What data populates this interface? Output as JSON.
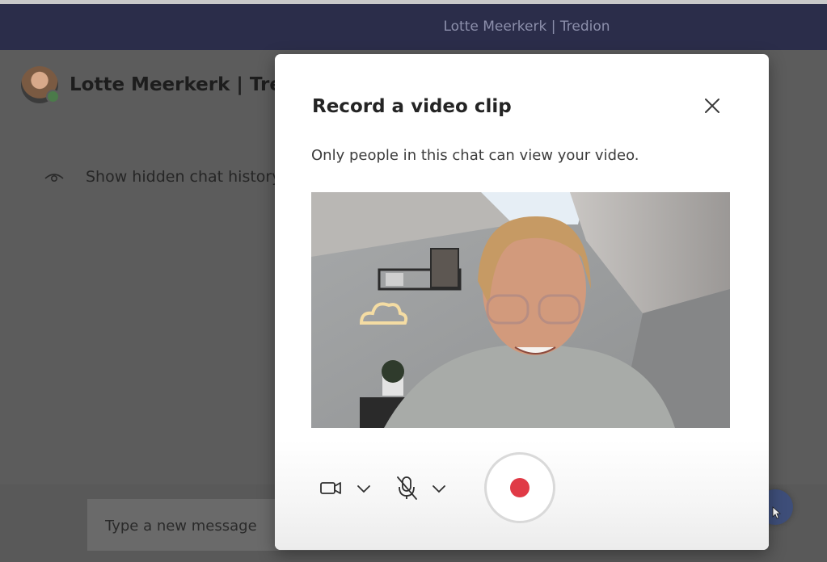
{
  "window": {
    "title": "Lotte Meerkerk | Tredion"
  },
  "chat": {
    "name": "Lotte Meerkerk | Tredion",
    "hidden_history_label": "Show hidden chat history",
    "composer_placeholder": "Type a new message"
  },
  "dialog": {
    "title": "Record a video clip",
    "subtitle": "Only people in this chat can view your video.",
    "close_icon": "close-icon",
    "controls": {
      "camera_icon": "camera-icon",
      "mic_icon": "mic-off-icon",
      "record_icon": "record-icon"
    }
  },
  "colors": {
    "titlebar": "#2b2d4a",
    "record": "#e03a46",
    "overlay": "#5c5c5c"
  }
}
